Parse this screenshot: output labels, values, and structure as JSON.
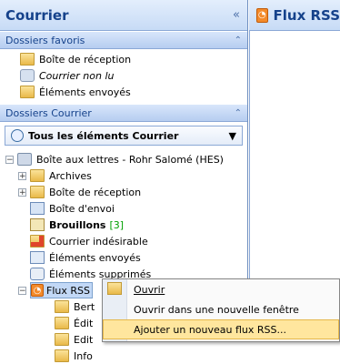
{
  "nav": {
    "title": "Courrier",
    "collapse_glyph": "«",
    "favorites": {
      "header": "Dossiers favoris",
      "items": [
        {
          "label": "Boîte de réception",
          "icon": "inbox-icon"
        },
        {
          "label": "Courrier non lu",
          "icon": "search-folder-icon",
          "italic": true
        },
        {
          "label": "Éléments envoyés",
          "icon": "sent-items-icon"
        }
      ]
    },
    "mail_folders": {
      "header": "Dossiers Courrier",
      "all_items": "Tous les éléments Courrier"
    },
    "tree": {
      "root": "Boîte aux lettres - Rohr Salomé (HES)",
      "items": [
        {
          "label": "Archives"
        },
        {
          "label": "Boîte de réception"
        },
        {
          "label": "Boîte d'envoi"
        },
        {
          "label": "Brouillons",
          "count": "[3]"
        },
        {
          "label": "Courrier indésirable"
        },
        {
          "label": "Éléments envoyés"
        },
        {
          "label": "Éléments supprimés"
        },
        {
          "label": "Flux RSS"
        },
        {
          "label": "Bert"
        },
        {
          "label": "Édit"
        },
        {
          "label": "Edit"
        },
        {
          "label": "Info"
        }
      ]
    }
  },
  "main": {
    "title": "Flux RSS"
  },
  "context_menu": {
    "items": [
      {
        "label": "Ouvrir"
      },
      {
        "label": "Ouvrir dans une nouvelle fenêtre"
      },
      {
        "label": "Ajouter un nouveau flux RSS..."
      }
    ]
  },
  "colors": {
    "header_text": "#15428b",
    "highlight": "#ffe69e",
    "rss_orange": "#f38a2a"
  }
}
